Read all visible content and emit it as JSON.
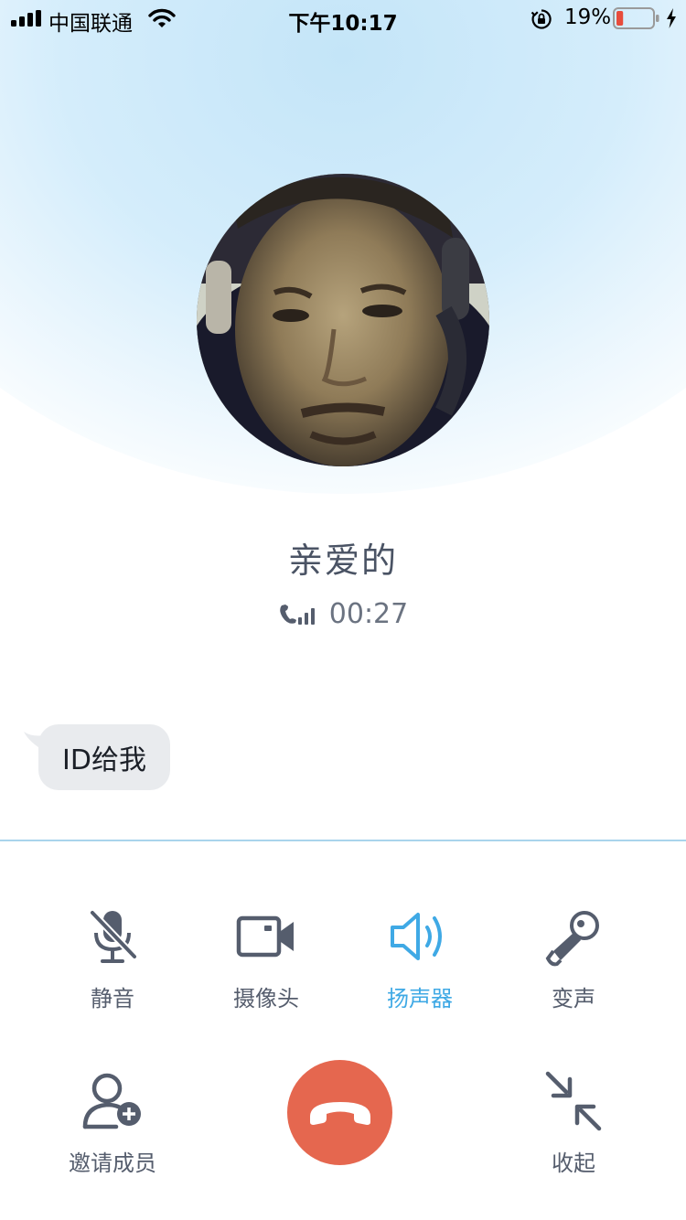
{
  "status_bar": {
    "carrier": "中国联通",
    "time": "下午10:17",
    "battery_percent": "19%",
    "battery_level": 0.19
  },
  "caller": {
    "name": "亲爱的",
    "duration": "00:27"
  },
  "message": {
    "text": "ID给我"
  },
  "controls": {
    "mute": "静音",
    "camera": "摄像头",
    "speaker": "扬声器",
    "voice_change": "变声",
    "invite": "邀请成员",
    "collapse": "收起"
  },
  "colors": {
    "accent": "#3fa9e5",
    "icon": "#555d6d",
    "hangup": "#e5674f",
    "battery_low": "#e74c3c"
  },
  "icons": {
    "mute": "mic-slash-icon",
    "camera": "video-camera-icon",
    "speaker": "speaker-icon",
    "voice_change": "voice-changer-mic-icon",
    "invite": "add-user-icon",
    "hangup": "phone-hangup-icon",
    "collapse": "minimize-arrows-icon"
  }
}
